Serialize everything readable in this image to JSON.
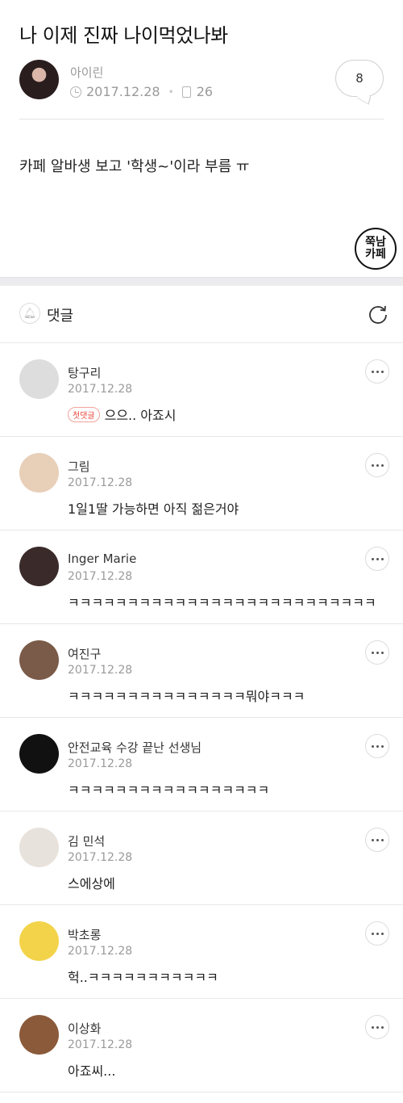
{
  "post": {
    "title": "나 이제 진짜 나이먹었나봐",
    "author": "아이린",
    "date": "2017.12.28",
    "views": "26",
    "comment_count": "8",
    "body": "카페 알바생 보고 '학생~'이라 부름 ㅠ",
    "stamp_line1": "쭉남",
    "stamp_line2": "카페"
  },
  "comments_section": {
    "title": "댓글"
  },
  "comments": [
    {
      "name": "탕구리",
      "date": "2017.12.28",
      "badge": "첫댓글",
      "text": "으으.. 아죠시",
      "avatar_color": "#ddd"
    },
    {
      "name": "그림",
      "date": "2017.12.28",
      "badge": "",
      "text": "1일1딸 가능하면 아직 젊은거야",
      "avatar_color": "#e8cfb8"
    },
    {
      "name": "Inger Marie",
      "date": "2017.12.28",
      "badge": "",
      "text": "ㅋㅋㅋㅋㅋㅋㅋㅋㅋㅋㅋㅋㅋㅋㅋㅋㅋㅋㅋㅋㅋㅋㅋㅋㅋㅋ",
      "avatar_color": "#3a2a2a"
    },
    {
      "name": "여진구",
      "date": "2017.12.28",
      "badge": "",
      "text": "ㅋㅋㅋㅋㅋㅋㅋㅋㅋㅋㅋㅋㅋㅋㅋ뭐야ㅋㅋㅋ",
      "avatar_color": "#7a5a48"
    },
    {
      "name": "안전교육 수강 끝난 선생님",
      "date": "2017.12.28",
      "badge": "",
      "text": "ㅋㅋㅋㅋㅋㅋㅋㅋㅋㅋㅋㅋㅋㅋㅋㅋㅋ",
      "avatar_color": "#111"
    },
    {
      "name": "김 민석",
      "date": "2017.12.28",
      "badge": "",
      "text": "스에상에",
      "avatar_color": "#e8e2dc"
    },
    {
      "name": "박초롱",
      "date": "2017.12.28",
      "badge": "",
      "text": "헉..ㅋㅋㅋㅋㅋㅋㅋㅋㅋㅋㅋ",
      "avatar_color": "#f3d34a"
    },
    {
      "name": "이상화",
      "date": "2017.12.28",
      "badge": "",
      "text": "아죠씨...",
      "avatar_color": "#8a5a3a"
    }
  ]
}
